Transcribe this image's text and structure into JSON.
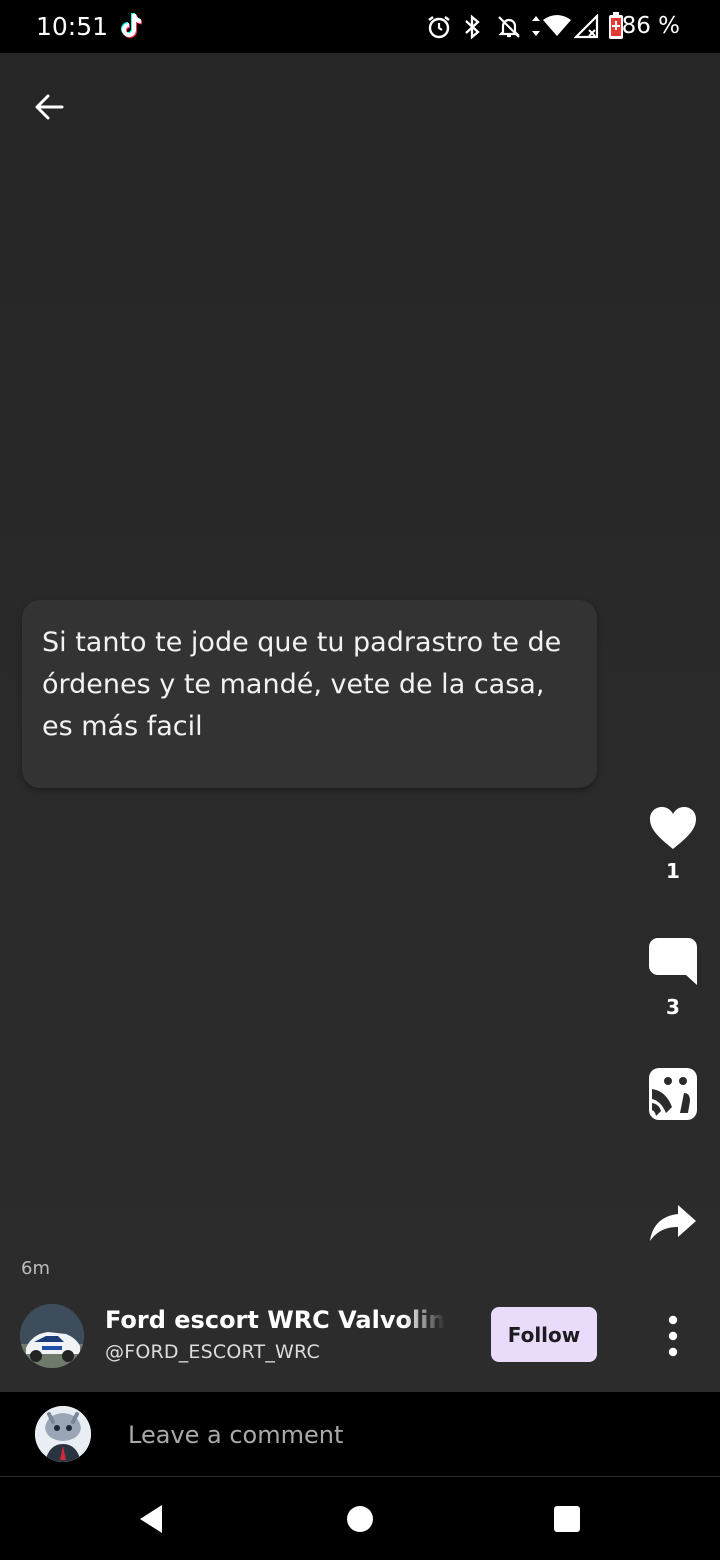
{
  "status_bar": {
    "time": "10:51",
    "battery": "86 %",
    "icons": [
      "tiktok-icon",
      "alarm-icon",
      "bluetooth-icon",
      "mute-icon",
      "wifi-icon",
      "signal-icon",
      "battery-icon"
    ]
  },
  "header": {
    "back_icon": "arrow-left-icon"
  },
  "post": {
    "text": "Si tanto te jode que tu padrastro te de órdenes y te mandé, vete de la casa, es más facil",
    "age": "6m"
  },
  "actions": {
    "like_count": "1",
    "comment_count": "3",
    "icons": [
      "heart-icon",
      "comment-icon",
      "duet-icon",
      "share-icon"
    ]
  },
  "author": {
    "name": "Ford escort WRC Valvoline",
    "handle": "@FORD_ESCORT_WRC",
    "follow_label": "Follow"
  },
  "comment_bar": {
    "placeholder": "Leave a comment"
  },
  "nav": {
    "icons": [
      "back-triangle-icon",
      "home-circle-icon",
      "recents-square-icon"
    ]
  },
  "colors": {
    "background": "#2b2b2b",
    "card": "#333333",
    "follow_button": "#e8dcfa",
    "bars": "#000000"
  }
}
